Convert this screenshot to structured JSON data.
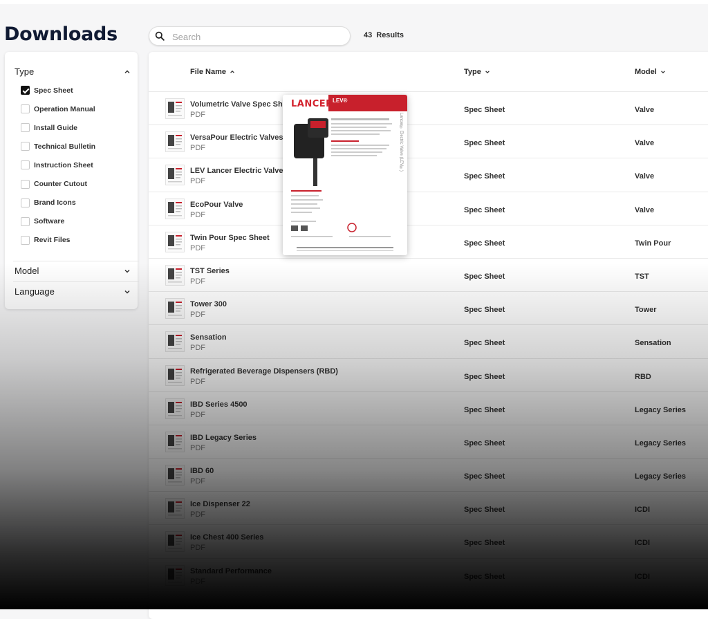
{
  "page": {
    "title": "Downloads"
  },
  "search": {
    "placeholder": "Search",
    "value": ""
  },
  "results": {
    "count": "43",
    "label": "Results"
  },
  "filters": {
    "type": {
      "heading": "Type",
      "options": [
        {
          "label": "Spec Sheet",
          "checked": true
        },
        {
          "label": "Operation Manual",
          "checked": false
        },
        {
          "label": "Install Guide",
          "checked": false
        },
        {
          "label": "Technical Bulletin",
          "checked": false
        },
        {
          "label": "Instruction Sheet",
          "checked": false
        },
        {
          "label": "Counter Cutout",
          "checked": false
        },
        {
          "label": "Brand Icons",
          "checked": false
        },
        {
          "label": "Software",
          "checked": false
        },
        {
          "label": "Revit Files",
          "checked": false
        }
      ]
    },
    "model": {
      "heading": "Model"
    },
    "language": {
      "heading": "Language"
    }
  },
  "table": {
    "columns": {
      "file_name": "File Name",
      "type": "Type",
      "model": "Model"
    },
    "rows": [
      {
        "name": "Volumetric Valve Spec Sheet",
        "file_type": "PDF",
        "type": "Spec Sheet",
        "model": "Valve"
      },
      {
        "name": "VersaPour Electric Valves",
        "file_type": "PDF",
        "type": "Spec Sheet",
        "model": "Valve"
      },
      {
        "name": "LEV Lancer Electric Valve",
        "file_type": "PDF",
        "type": "Spec Sheet",
        "model": "Valve"
      },
      {
        "name": "EcoPour Valve",
        "file_type": "PDF",
        "type": "Spec Sheet",
        "model": "Valve"
      },
      {
        "name": "Twin Pour Spec Sheet",
        "file_type": "PDF",
        "type": "Spec Sheet",
        "model": "Twin Pour"
      },
      {
        "name": "TST Series",
        "file_type": "PDF",
        "type": "Spec Sheet",
        "model": "TST"
      },
      {
        "name": "Tower 300",
        "file_type": "PDF",
        "type": "Spec Sheet",
        "model": "Tower"
      },
      {
        "name": "Sensation",
        "file_type": "PDF",
        "type": "Spec Sheet",
        "model": "Sensation"
      },
      {
        "name": "Refrigerated Beverage Dispensers (RBD)",
        "file_type": "PDF",
        "type": "Spec Sheet",
        "model": "RBD"
      },
      {
        "name": "IBD Series 4500",
        "file_type": "PDF",
        "type": "Spec Sheet",
        "model": "Legacy Series"
      },
      {
        "name": "IBD Legacy Series",
        "file_type": "PDF",
        "type": "Spec Sheet",
        "model": "Legacy Series"
      },
      {
        "name": "IBD 60",
        "file_type": "PDF",
        "type": "Spec Sheet",
        "model": "Legacy Series"
      },
      {
        "name": "Ice Dispenser 22",
        "file_type": "PDF",
        "type": "Spec Sheet",
        "model": "ICDI"
      },
      {
        "name": "Ice Chest 400 Series",
        "file_type": "PDF",
        "type": "Spec Sheet",
        "model": "ICDI"
      },
      {
        "name": "Standard Performance",
        "file_type": "PDF",
        "type": "Spec Sheet",
        "model": "ICDI"
      }
    ]
  },
  "preview": {
    "logo": "LANCER",
    "code": "LEV®",
    "side_text": "Lancer® Electric Valve (LEV®)"
  },
  "colors": {
    "brand_red": "#d3232e",
    "title_navy": "#101a33",
    "fade_to": "#000000"
  }
}
